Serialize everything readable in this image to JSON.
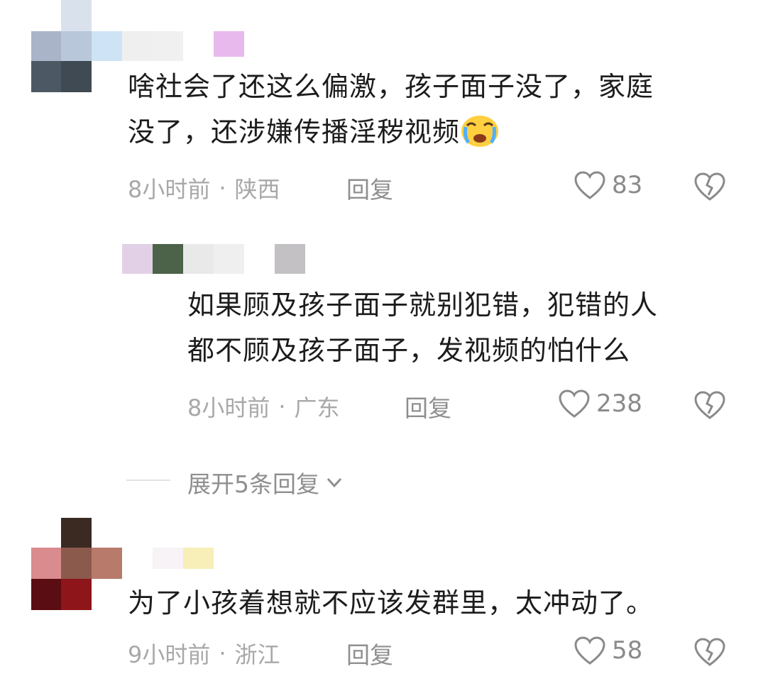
{
  "comments": [
    {
      "text_line1": "啥社会了还这么偏激，孩子面子没了，家庭",
      "text_line2": "没了，还涉嫌传播淫秽视频",
      "emoji": "crying-face-emoji",
      "time": "8小时前",
      "separator": "·",
      "location": "陕西",
      "reply_label": "回复",
      "likes": "83"
    },
    {
      "text_line1": "如果顾及孩子面子就别犯错，犯错的人",
      "text_line2": "都不顾及孩子面子，发视频的怕什么",
      "time": "8小时前",
      "separator": "·",
      "location": "广东",
      "reply_label": "回复",
      "likes": "238"
    },
    {
      "text_line1": "为了小孩着想就不应该发群里，太冲动了。",
      "time": "9小时前",
      "separator": "·",
      "location": "浙江",
      "reply_label": "回复",
      "likes": "58"
    }
  ],
  "expand_replies_label": "展开5条回复",
  "icons": {
    "like": "heart-outline-icon",
    "dislike": "broken-heart-icon",
    "expand": "chevron-down-icon"
  },
  "colors": {
    "text": "#1c1c1c",
    "meta": "#a8a8a8",
    "icon": "#8a8a8a"
  }
}
